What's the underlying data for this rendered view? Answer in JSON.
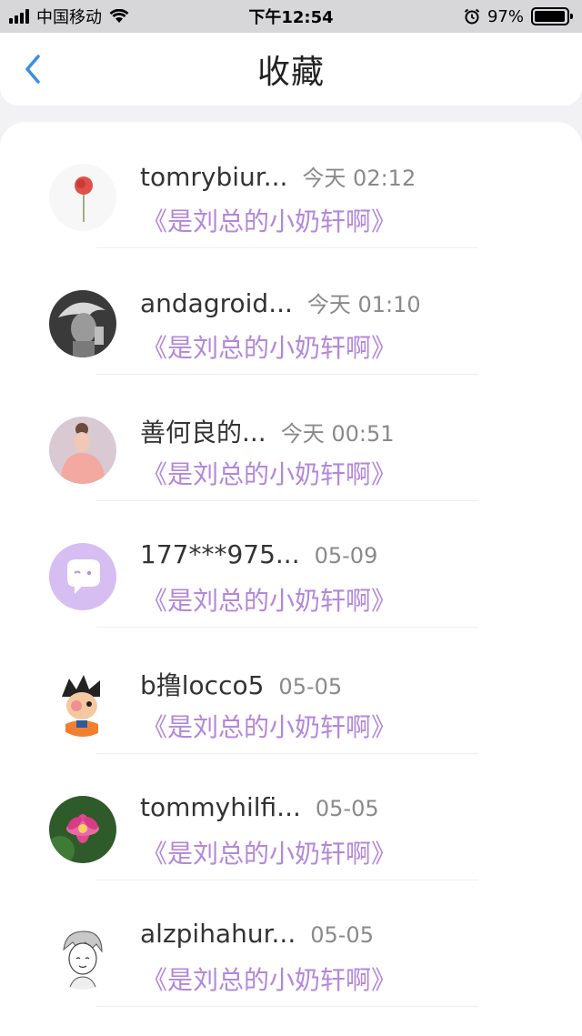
{
  "status_bar": {
    "carrier": "中国移动",
    "time": "下午12:54",
    "battery_percent": "97%",
    "battery_level": 0.97
  },
  "nav": {
    "title": "收藏",
    "back_icon": "chevron-left-icon",
    "accent_color": "#3a8ee6"
  },
  "list": {
    "items": [
      {
        "name": "tomrybiur...",
        "time": "今天 02:12",
        "subtitle": "《是刘总的小奶轩啊》",
        "avatar": "rose-avatar"
      },
      {
        "name": "andagroid...",
        "time": "今天 01:10",
        "subtitle": "《是刘总的小奶轩啊》",
        "avatar": "bw-portrait-avatar"
      },
      {
        "name": "善何良的...",
        "time": "今天 00:51",
        "subtitle": "《是刘总的小奶轩啊》",
        "avatar": "pink-portrait-avatar"
      },
      {
        "name": "177***975...",
        "time": "05-09",
        "subtitle": "《是刘总的小奶轩啊》",
        "avatar": "chat-bubble-avatar"
      },
      {
        "name": "b撸locco5",
        "time": "05-05",
        "subtitle": "《是刘总的小奶轩啊》",
        "avatar": "cartoon-avatar"
      },
      {
        "name": "tommyhilfi...",
        "time": "05-05",
        "subtitle": "《是刘总的小奶轩啊》",
        "avatar": "lotus-avatar"
      },
      {
        "name": "alzpihahur...",
        "time": "05-05",
        "subtitle": "《是刘总的小奶轩啊》",
        "avatar": "sketch-avatar"
      }
    ]
  },
  "colors": {
    "subtitle": "#b387db",
    "name": "#333333",
    "time": "#8a8a8a"
  }
}
